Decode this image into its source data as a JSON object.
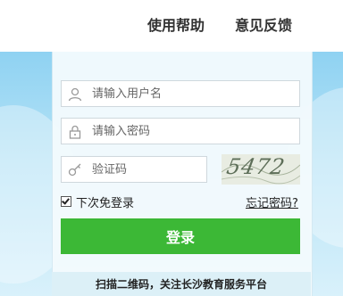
{
  "nav": {
    "help": "使用帮助",
    "feedback": "意见反馈"
  },
  "form": {
    "username_placeholder": "请输入用户名",
    "password_placeholder": "请输入密码",
    "captcha_placeholder": "验证码",
    "captcha_image_text": "5472",
    "remember_label": "下次免登录",
    "remember_checked": true,
    "forgot_label": "忘记密码?",
    "login_label": "登录"
  },
  "footer": {
    "text": "扫描二维码，关注长沙教育服务平台"
  },
  "colors": {
    "login_button": "#3cb836",
    "hero_top": "#8fd2f2",
    "hero_bottom": "#d9f1fb"
  }
}
